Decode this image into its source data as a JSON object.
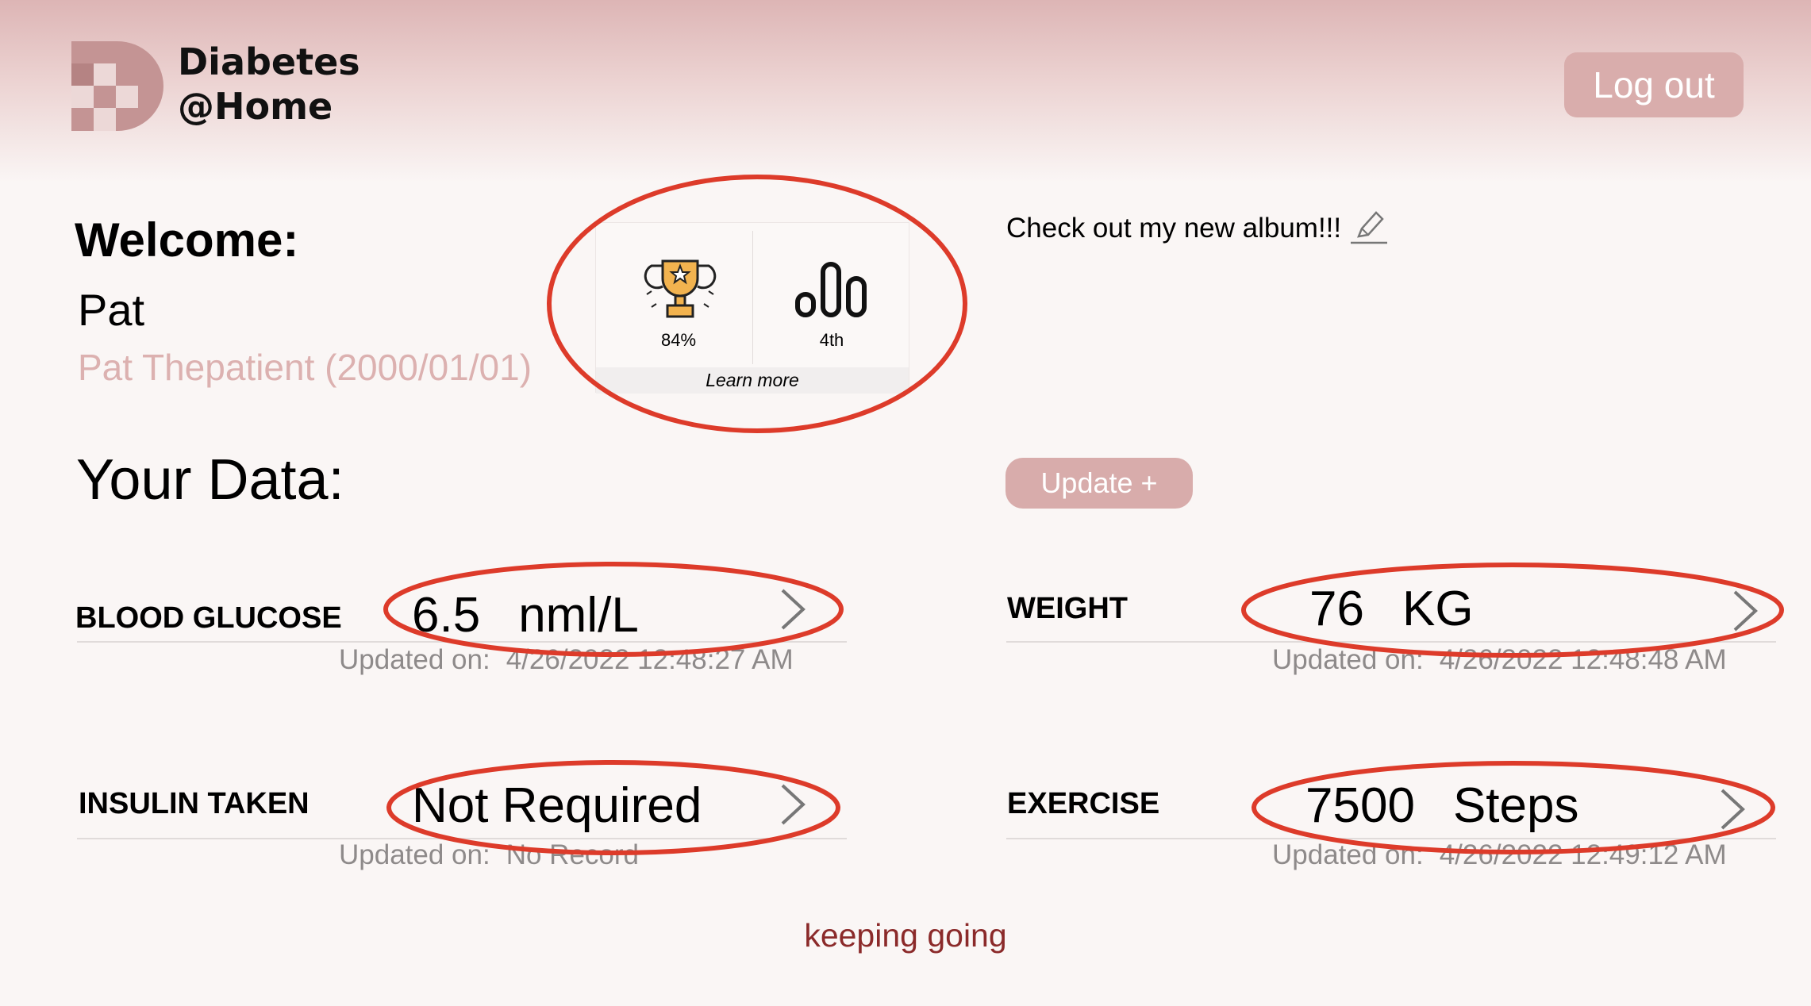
{
  "header": {
    "brand_line1": "Diabetes",
    "brand_line2": "@Home",
    "logout_label": "Log out",
    "logo_icon": "checker-d-logo-icon"
  },
  "welcome": {
    "label": "Welcome:",
    "name": "Pat",
    "full_name": "Pat Thepatient (2000/01/01)"
  },
  "stats": {
    "achievement_value": "84%",
    "achievement_icon": "trophy-icon",
    "rank_value": "4th",
    "rank_icon": "bar-chart-icon",
    "learn_more": "Learn more"
  },
  "status_message": {
    "text": "Check out my new album!!!",
    "edit_icon": "pencil-icon"
  },
  "data_section": {
    "title": "Your Data:",
    "update_label": "Update +",
    "updated_prefix": "Updated on:"
  },
  "metrics": {
    "blood_glucose": {
      "label": "BLOOD GLUCOSE",
      "value": "6.5",
      "unit": "nml/L",
      "updated": "4/26/2022 12:48:27 AM"
    },
    "weight": {
      "label": "WEIGHT",
      "value": "76",
      "unit": "KG",
      "updated": "4/26/2022 12:48:48 AM"
    },
    "insulin": {
      "label": "INSULIN TAKEN",
      "value": "Not Required",
      "unit": "",
      "updated": "No Record"
    },
    "exercise": {
      "label": "EXERCISE",
      "value": "7500",
      "unit": "Steps",
      "updated": "4/26/2022 12:49:12 AM"
    }
  },
  "footer": {
    "message": "keeping going"
  },
  "colors": {
    "accent": "#d9adac",
    "muted_pink_text": "#dcb1b0",
    "annotation_red": "#dd3b2a",
    "footer_text": "#8b2a2a"
  }
}
